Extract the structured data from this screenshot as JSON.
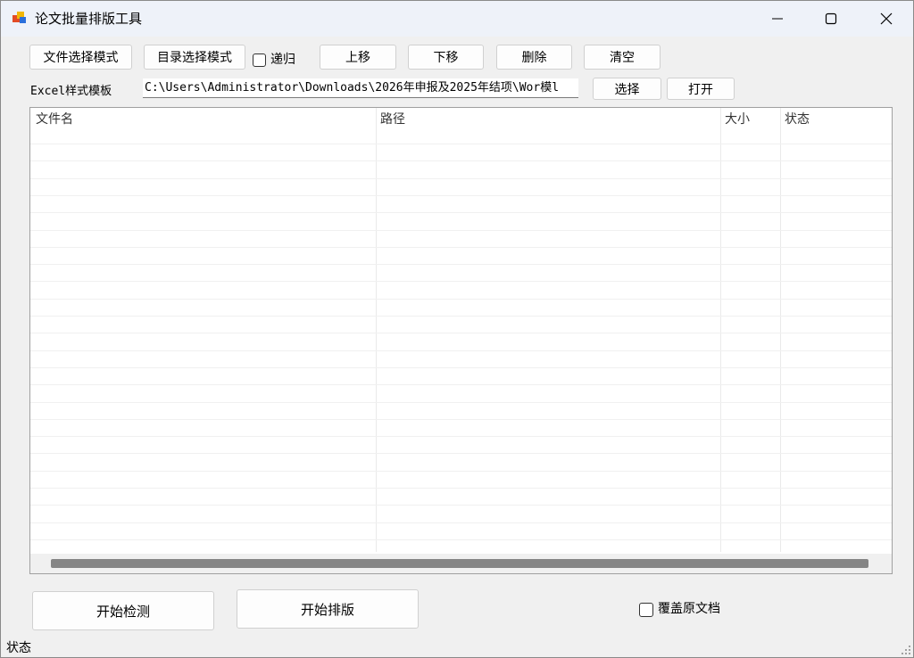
{
  "window": {
    "title": "论文批量排版工具"
  },
  "toolbar": {
    "file_mode_label": "文件选择模式",
    "dir_mode_label": "目录选择模式",
    "recursive_label": "递归",
    "recursive_checked": false,
    "move_up_label": "上移",
    "move_down_label": "下移",
    "delete_label": "删除",
    "clear_label": "清空"
  },
  "template": {
    "label": "Excel样式模板",
    "path_value": "C:\\Users\\Administrator\\Downloads\\2026年申报及2025年结项\\Wor模l",
    "select_label": "选择",
    "open_label": "打开"
  },
  "file_list": {
    "columns": [
      "文件名",
      "路径",
      "大小",
      "状态"
    ],
    "rows": []
  },
  "actions": {
    "start_check_label": "开始检测",
    "start_format_label": "开始排版",
    "overwrite_label": "覆盖原文档",
    "overwrite_checked": false
  },
  "statusbar": {
    "text": "状态"
  }
}
